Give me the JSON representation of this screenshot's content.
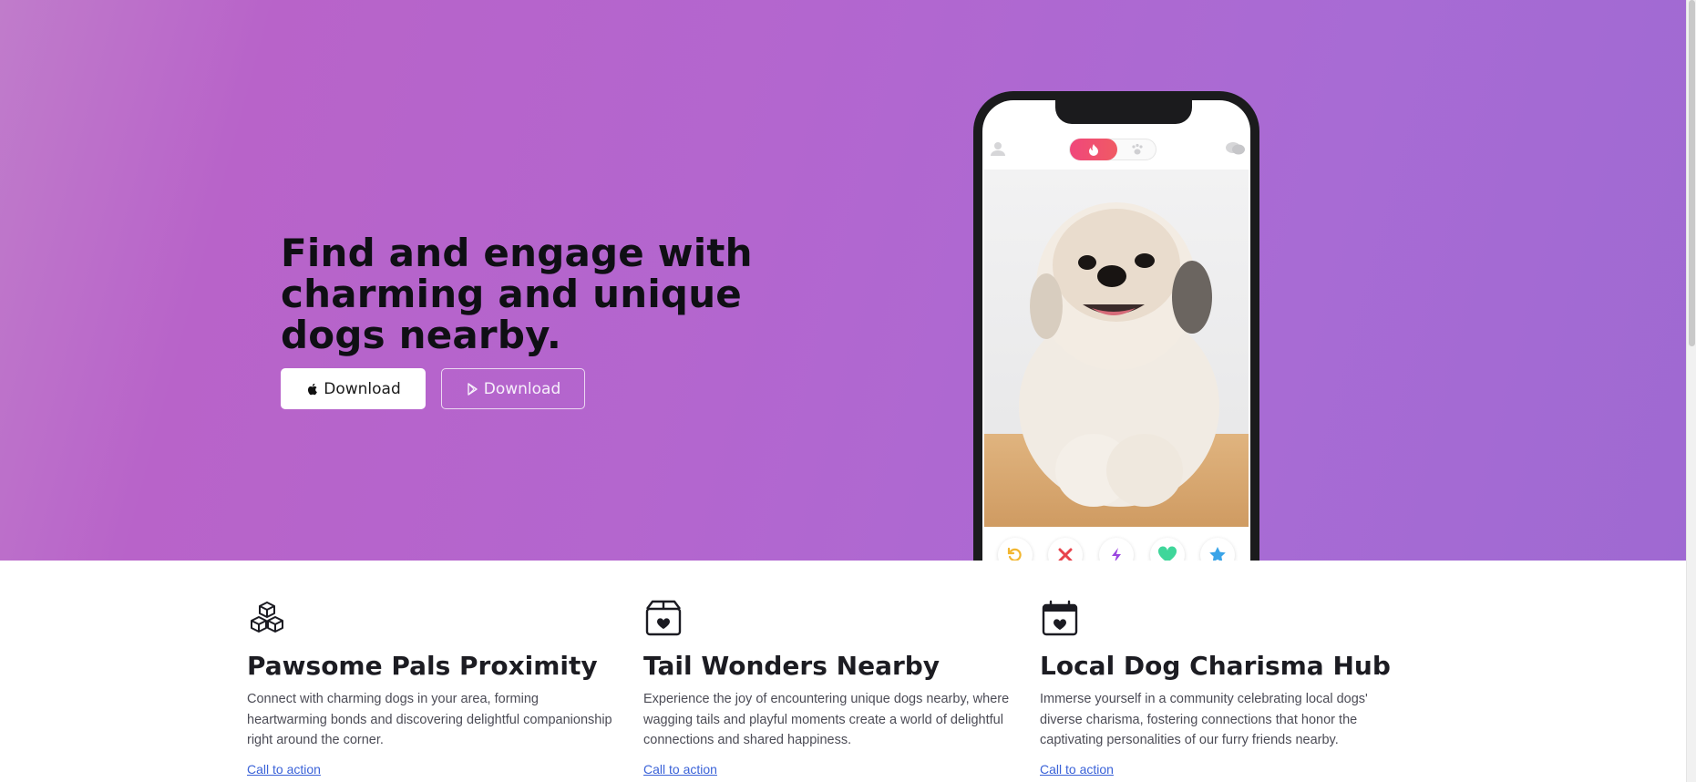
{
  "hero": {
    "title": "Find and engage with charming and unique dogs nearby.",
    "buttons": [
      {
        "label": "Download",
        "icon": "apple-icon"
      },
      {
        "label": "Download",
        "icon": "play-store-icon"
      }
    ]
  },
  "phone": {
    "header_icons": [
      "user-icon",
      "flame-icon",
      "paw-icon",
      "chat-icon"
    ],
    "actions": [
      {
        "icon": "rewind-icon",
        "color": "#f2b630"
      },
      {
        "icon": "close-icon",
        "color": "#e8434c"
      },
      {
        "icon": "bolt-icon",
        "color": "#9b46e0"
      },
      {
        "icon": "heart-icon",
        "color": "#3fd69a"
      },
      {
        "icon": "star-icon",
        "color": "#3aa4e8"
      }
    ]
  },
  "features": [
    {
      "icon": "boxes-icon",
      "title": "Pawsome Pals Proximity",
      "description": "Connect with charming dogs in your area, forming heartwarming bonds and discovering delightful companionship right around the corner.",
      "link": "Call to action"
    },
    {
      "icon": "box-heart-icon",
      "title": "Tail Wonders Nearby",
      "description": "Experience the joy of encountering unique dogs nearby, where wagging tails and playful moments create a world of delightful connections and shared happiness.",
      "link": "Call to action"
    },
    {
      "icon": "calendar-heart-icon",
      "title": "Local Dog Charisma Hub",
      "description": "Immerse yourself in a community celebrating local dogs' diverse charisma, fostering connections that honor the captivating personalities of our furry friends nearby.",
      "link": "Call to action"
    }
  ],
  "colors": {
    "hero_gradient_start": "#c07ccb",
    "hero_gradient_end": "#9f69d2",
    "link": "#3a62d8",
    "toggle_accent": "#f0477b"
  }
}
